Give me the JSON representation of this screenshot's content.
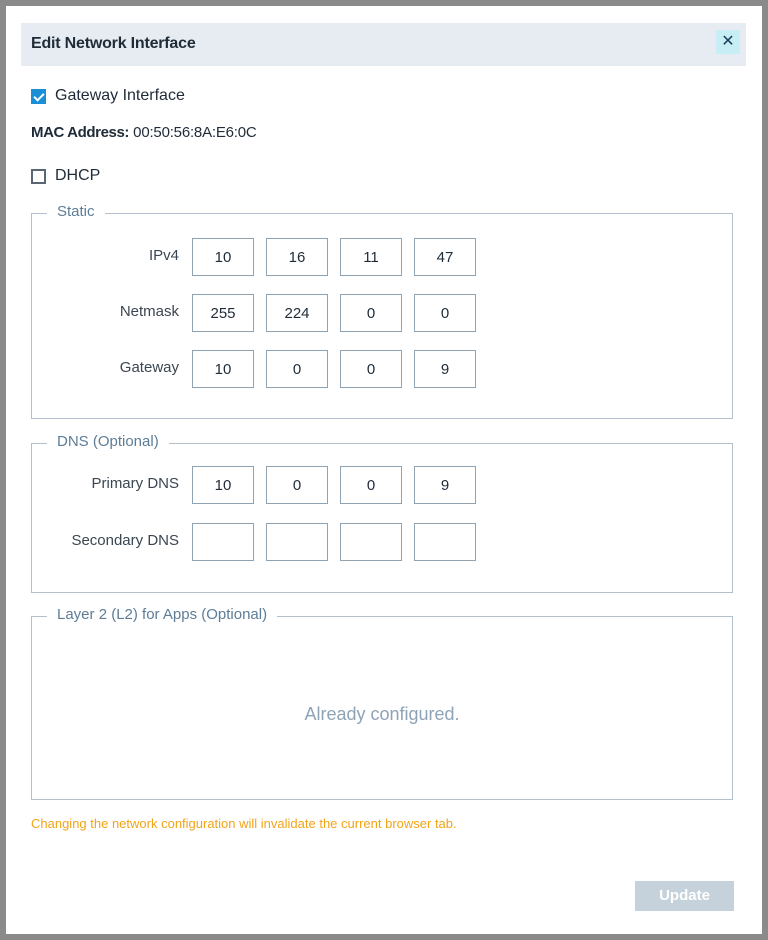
{
  "dialog": {
    "title": "Edit Network Interface",
    "close_glyph": "✕"
  },
  "gateway_interface": {
    "label": "Gateway Interface",
    "checked": true
  },
  "mac": {
    "label": "MAC Address:",
    "value": "00:50:56:8A:E6:0C"
  },
  "dhcp": {
    "label": "DHCP",
    "checked": false
  },
  "static": {
    "legend": "Static",
    "ipv4": {
      "label": "IPv4",
      "octets": [
        "10",
        "16",
        "11",
        "47"
      ]
    },
    "netmask": {
      "label": "Netmask",
      "octets": [
        "255",
        "224",
        "0",
        "0"
      ]
    },
    "gateway": {
      "label": "Gateway",
      "octets": [
        "10",
        "0",
        "0",
        "9"
      ]
    }
  },
  "dns": {
    "legend": "DNS (Optional)",
    "primary": {
      "label": "Primary DNS",
      "octets": [
        "10",
        "0",
        "0",
        "9"
      ]
    },
    "secondary": {
      "label": "Secondary DNS",
      "octets": [
        "",
        "",
        "",
        ""
      ]
    }
  },
  "layer2": {
    "legend": "Layer 2 (L2) for Apps (Optional)",
    "message": "Already configured."
  },
  "warning": "Changing the network configuration will invalidate the current browser tab.",
  "update_label": "Update",
  "colors": {
    "accent": "#1a8ed6",
    "warning": "#f2a416",
    "header_bg": "#e6ecf1",
    "close_bg": "#c7eef4",
    "disabled_button": "#c6d2db"
  },
  "icons": {
    "close": "close-icon",
    "check": "checkmark-icon"
  }
}
